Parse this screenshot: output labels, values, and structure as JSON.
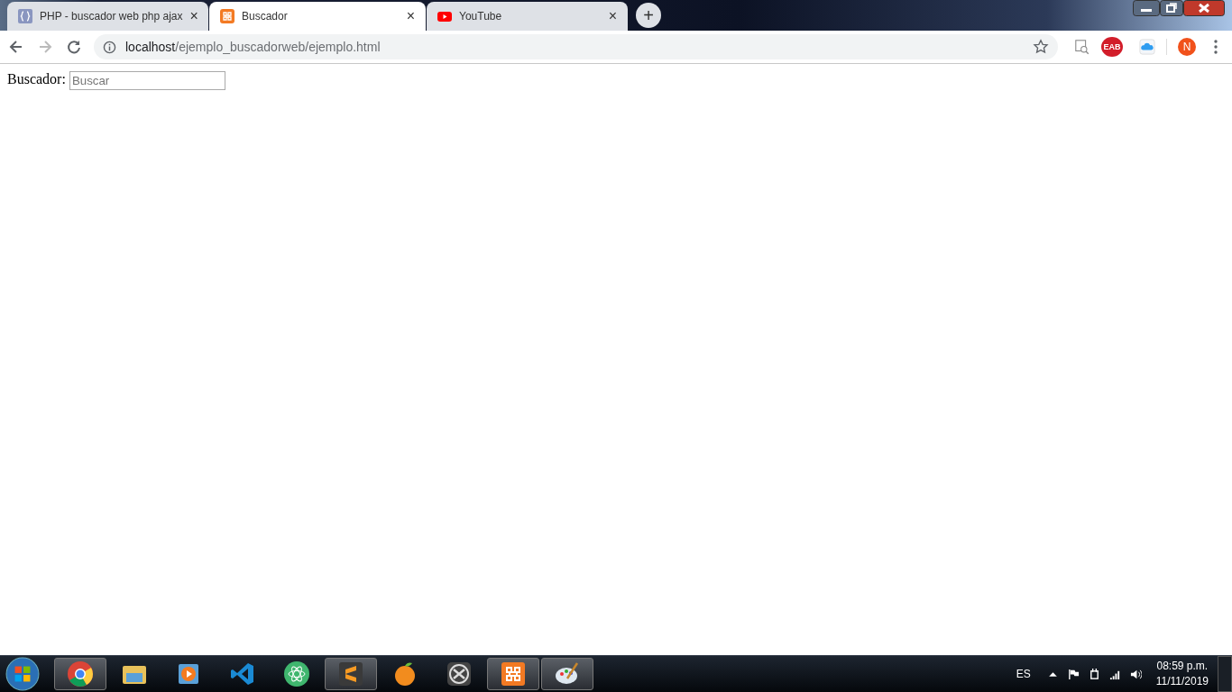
{
  "tabs": [
    {
      "kind": "braces",
      "title": "PHP - buscador web php ajax",
      "close": "×",
      "selected": false
    },
    {
      "kind": "xampp",
      "title": "Buscador",
      "close": "×",
      "selected": true
    },
    {
      "kind": "youtube",
      "title": "YouTube",
      "close": "×",
      "selected": false
    }
  ],
  "new_tab": "+",
  "address": {
    "host": "localhost",
    "path": "/ejemplo_buscadorweb/ejemplo.html"
  },
  "extensions": {
    "adblock": "EAB",
    "avatar": "N"
  },
  "page": {
    "label": "Buscador:",
    "placeholder": "Buscar"
  },
  "taskbar": {
    "apps": [
      {
        "kind": "chrome",
        "open": true
      },
      {
        "kind": "folder",
        "open": false
      },
      {
        "kind": "player",
        "open": false
      },
      {
        "kind": "vscode",
        "open": false
      },
      {
        "kind": "atom",
        "open": false
      },
      {
        "kind": "sublime",
        "open": true
      },
      {
        "kind": "fruit",
        "open": false
      },
      {
        "kind": "circle",
        "open": false
      },
      {
        "kind": "xampp",
        "open": true
      },
      {
        "kind": "paint",
        "open": true
      }
    ],
    "language": "ES",
    "time": "08:59 p.m.",
    "date": "11/11/2019"
  }
}
